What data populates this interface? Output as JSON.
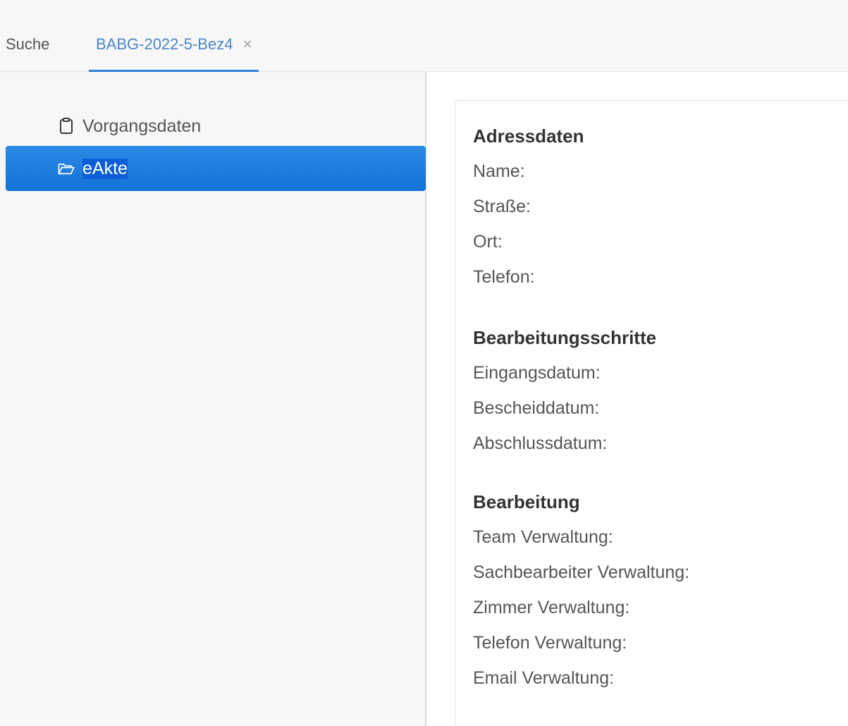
{
  "tabs": {
    "search_label": "Suche",
    "active_label": "BABG-2022-5-Bez4",
    "close_glyph": "×"
  },
  "sidebar": {
    "items": [
      {
        "label": "Vorgangsdaten",
        "icon": "clipboard-icon"
      },
      {
        "label": "eAkte",
        "icon": "folder-open-icon",
        "selected": true
      }
    ]
  },
  "detail": {
    "sections": [
      {
        "title": "Adressdaten",
        "fields": [
          "Name:",
          "Straße:",
          "Ort:",
          "Telefon:"
        ]
      },
      {
        "title": "Bearbeitungsschritte",
        "fields": [
          "Eingangsdatum:",
          "Bescheiddatum:",
          "Abschlussdatum:"
        ]
      },
      {
        "title": "Bearbeitung",
        "fields": [
          "Team Verwaltung:",
          "Sachbearbeiter Verwaltung:",
          "Zimmer Verwaltung:",
          "Telefon Verwaltung:",
          "Email Verwaltung:"
        ]
      }
    ]
  },
  "colors": {
    "accent": "#2f7ed8",
    "selected_bg": "#1f7fe0",
    "tab_active_text": "#4a86c8"
  }
}
